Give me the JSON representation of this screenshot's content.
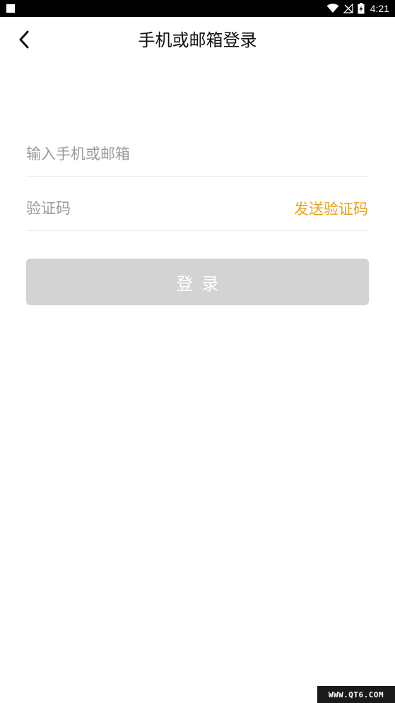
{
  "status_bar": {
    "time": "4:21",
    "battery_level_fraction": 0.6,
    "icons": [
      "notification-square-icon",
      "wifi-icon",
      "no-signal-icon",
      "battery-charging-icon"
    ]
  },
  "header": {
    "title": "手机或邮箱登录",
    "back_icon": "chevron-left-icon"
  },
  "form": {
    "account_placeholder": "输入手机或邮箱",
    "account_value": "",
    "code_placeholder": "验证码",
    "code_value": "",
    "send_code_label": "发送验证码"
  },
  "login_button": {
    "label": "登录",
    "enabled": false
  },
  "watermark": {
    "text": "WWW.QT6.COM"
  },
  "colors": {
    "accent": "#e8a21c",
    "button_disabled_bg": "#d3d3d3",
    "button_disabled_text": "#ffffff",
    "divider": "#ebebeb",
    "placeholder": "#9a9a9a"
  }
}
